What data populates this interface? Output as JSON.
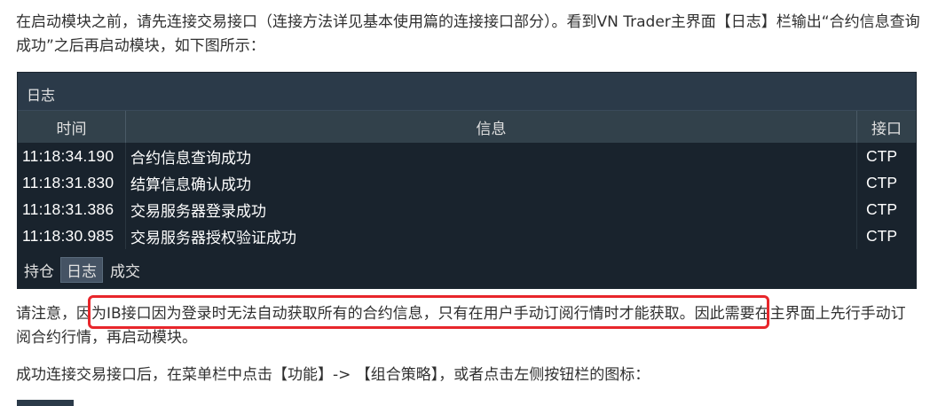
{
  "paragraphs": {
    "p1": "在启动模块之前，请先连接交易接口（连接方法详见基本使用篇的连接接口部分）。看到VN Trader主界面【日志】栏输出“合约信息查询成功”之后再启动模块，如下图所示：",
    "p2": "请注意，因为IB接口因为登录时无法自动获取所有的合约信息，只有在用户手动订阅行情时才能获取。因此需要在主界面上先行手动订阅合约行情，再启动模块。",
    "p3": "成功连接交易接口后，在菜单栏中点击【功能】-> 【组合策略】，或者点击左侧按钮栏的图标："
  },
  "log_panel": {
    "title": "日志",
    "columns": [
      "时间",
      "信息",
      "接口"
    ],
    "rows": [
      {
        "time": "11:18:34.190",
        "message": "合约信息查询成功",
        "gateway": "CTP"
      },
      {
        "time": "11:18:31.830",
        "message": "结算信息确认成功",
        "gateway": "CTP"
      },
      {
        "time": "11:18:31.386",
        "message": "交易服务器登录成功",
        "gateway": "CTP"
      },
      {
        "time": "11:18:30.985",
        "message": "交易服务器授权验证成功",
        "gateway": "CTP"
      }
    ],
    "tabs": [
      "持仓",
      "日志",
      "成交"
    ],
    "active_tab": "日志"
  },
  "colors": {
    "highlight_border": "#e8262b",
    "panel_bg": "#19232d",
    "panel_title_bg": "#2b3a49"
  }
}
